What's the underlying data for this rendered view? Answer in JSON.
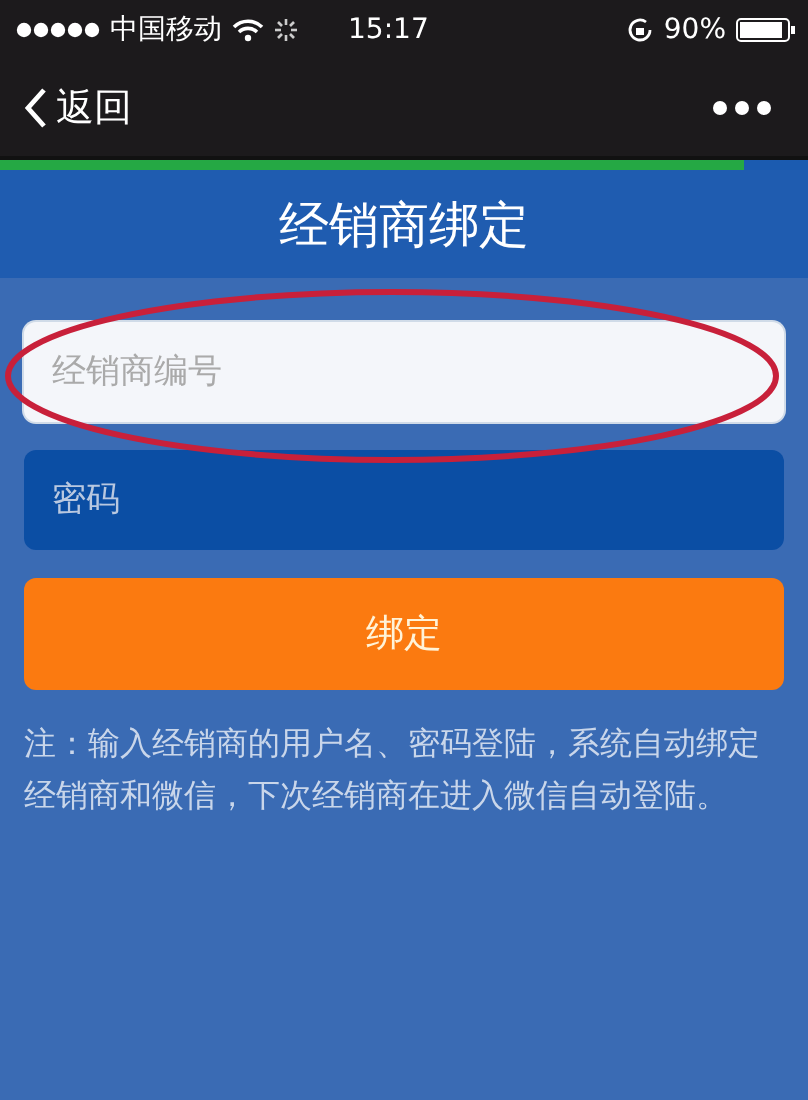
{
  "status_bar": {
    "carrier": "中国移动",
    "time": "15:17",
    "battery": "90%"
  },
  "nav": {
    "back": "返回"
  },
  "loading": {
    "level": 0.92
  },
  "header": {
    "title": "经销商绑定"
  },
  "form": {
    "fields": [
      {
        "placeholder": "经销商编号",
        "kind": "text",
        "focused": true
      },
      {
        "placeholder": "密码",
        "kind": "password",
        "focused": false
      }
    ],
    "button": "绑定",
    "note": "注：输入经销商的用户名、密码登陆，系统自动绑定经销商和微信，下次经销商在进入微信自动登陆。"
  },
  "annotation": {
    "kind": "ellipse",
    "color": "#c8203a"
  }
}
